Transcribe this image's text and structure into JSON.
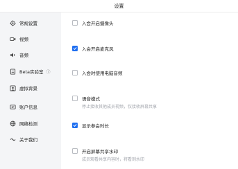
{
  "window": {
    "title": "设置"
  },
  "sidebar": {
    "items": [
      {
        "label": "常规设置",
        "icon": "gear-icon",
        "active": true
      },
      {
        "label": "视频",
        "icon": "video-icon"
      },
      {
        "label": "音频",
        "icon": "audio-icon"
      },
      {
        "label": "Beta实验室",
        "icon": "beta-lab-icon",
        "suffix_icon": "info-icon"
      },
      {
        "label": "虚拟背景",
        "icon": "virtual-background-icon"
      },
      {
        "label": "账户信息",
        "icon": "account-icon"
      },
      {
        "label": "网络检测",
        "icon": "network-icon"
      },
      {
        "label": "关于我们",
        "icon": "about-icon"
      }
    ]
  },
  "options": [
    {
      "label": "入会开启摄像头",
      "checked": false,
      "description": ""
    },
    {
      "label": "入会开启麦克风",
      "checked": true,
      "description": ""
    },
    {
      "label": "入会时使用电脑音频",
      "checked": false,
      "description": ""
    },
    {
      "label": "语音模式",
      "checked": false,
      "description": "停止接收其他成员视频，仅接收屏幕共享"
    },
    {
      "label": "显示参会时长",
      "checked": true,
      "description": ""
    },
    {
      "label": "开启屏幕共享水印",
      "checked": false,
      "description": "成员观看共享内容时，将看到水印"
    }
  ],
  "colors": {
    "accent": "#1f6ff0",
    "sidebar_bg": "#f4f5f7",
    "muted_text": "#a3a6ad"
  }
}
